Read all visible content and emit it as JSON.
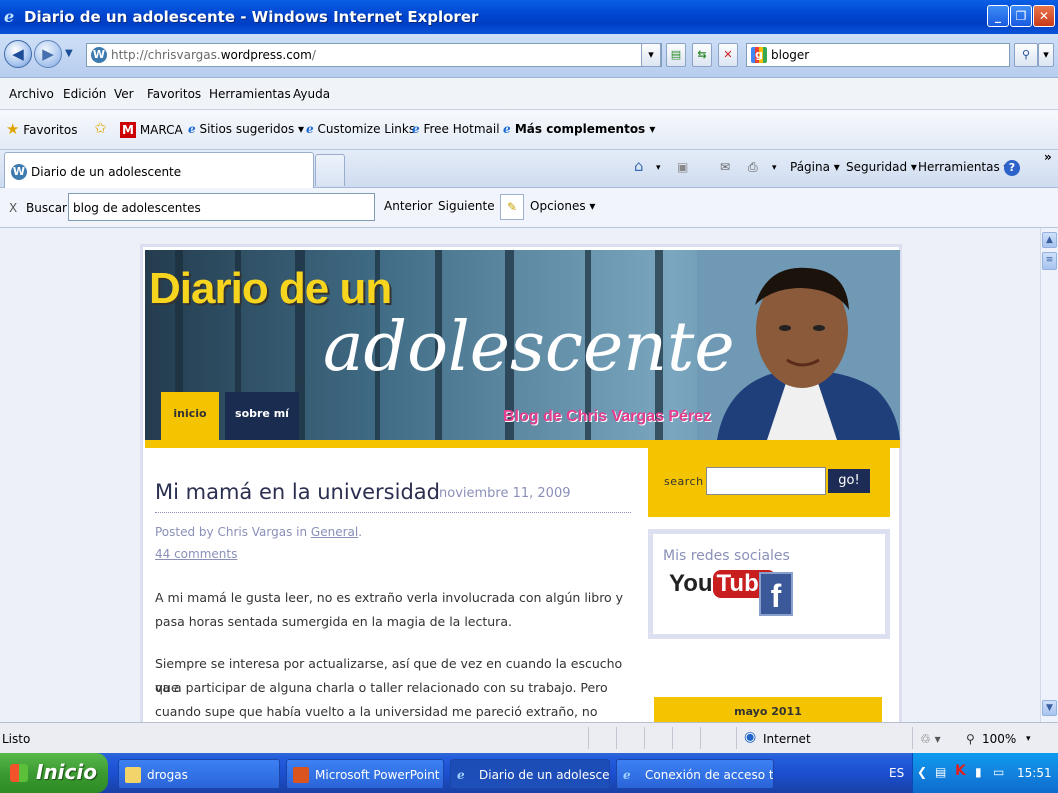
{
  "window": {
    "title": "Diario de un adolescente - Windows Internet Explorer"
  },
  "address_bar": {
    "url_prefix": "http://chrisvargas.",
    "url_domain": "wordpress.com",
    "url_suffix": "/",
    "search_value": "bloger"
  },
  "menu": {
    "items": [
      "Archivo",
      "Edición",
      "Ver",
      "Favoritos",
      "Herramientas",
      "Ayuda"
    ]
  },
  "favorites": {
    "favoritos_label": "Favoritos",
    "items": [
      "MARCA",
      "Sitios sugeridos ▾",
      "Customize Links",
      "Free Hotmail",
      "Más complementos ▾"
    ]
  },
  "tabs": {
    "active_tab": "Diario de un adolescente"
  },
  "command_bar": {
    "pagina": "Página ▾",
    "seguridad": "Seguridad ▾",
    "herramientas": "Herramientas ▾"
  },
  "find_bar": {
    "close": "X",
    "label": "Buscar:",
    "value": "blog de adolescentes",
    "previous": "Anterior",
    "next": "Siguiente",
    "options": "Opciones ▾"
  },
  "blog": {
    "header_title_1": "Diario de un",
    "header_title_2": "adolescente",
    "header_tagline": "Blog de Chris Vargas Pérez",
    "nav": [
      "inicio",
      "sobre mí"
    ],
    "post": {
      "title": "Mi mamá en la universidad",
      "date": "noviembre 11, 2009",
      "meta_prefix": "Posted by Chris Vargas in ",
      "meta_category": "General",
      "meta_suffix": ".",
      "comments": "44 comments",
      "paragraph_1_line_1": "A mi mamá le gusta leer, no es extraño verla involucrada con algún libro y",
      "paragraph_1_line_2": "pasa horas sentada sumergida en la magia de la lectura.",
      "paragraph_2_line_1": "Siempre se interesa por actualizarse, así que de vez en cuando la escucho que",
      "paragraph_2_line_2": "va a participar de alguna charla o taller relacionado con su trabajo. Pero",
      "paragraph_2_line_3": "cuando supe que había vuelto a la universidad me pareció extraño, no asimile"
    },
    "sidebar": {
      "search_label": "search",
      "search_button": "go!",
      "social_heading": "Mis redes sociales",
      "youtube_you": "You",
      "youtube_tube": "Tube",
      "facebook": "f",
      "calendar_month": "mayo 2011"
    }
  },
  "status_bar": {
    "status": "Listo",
    "zone": "Internet",
    "zoom": "100%"
  },
  "taskbar": {
    "start": "Inicio",
    "tasks": [
      "drogas",
      "Microsoft PowerPoint ...",
      "Diario de un adolesce...",
      "Conexión de acceso t..."
    ],
    "language": "ES",
    "clock": "15:51"
  }
}
